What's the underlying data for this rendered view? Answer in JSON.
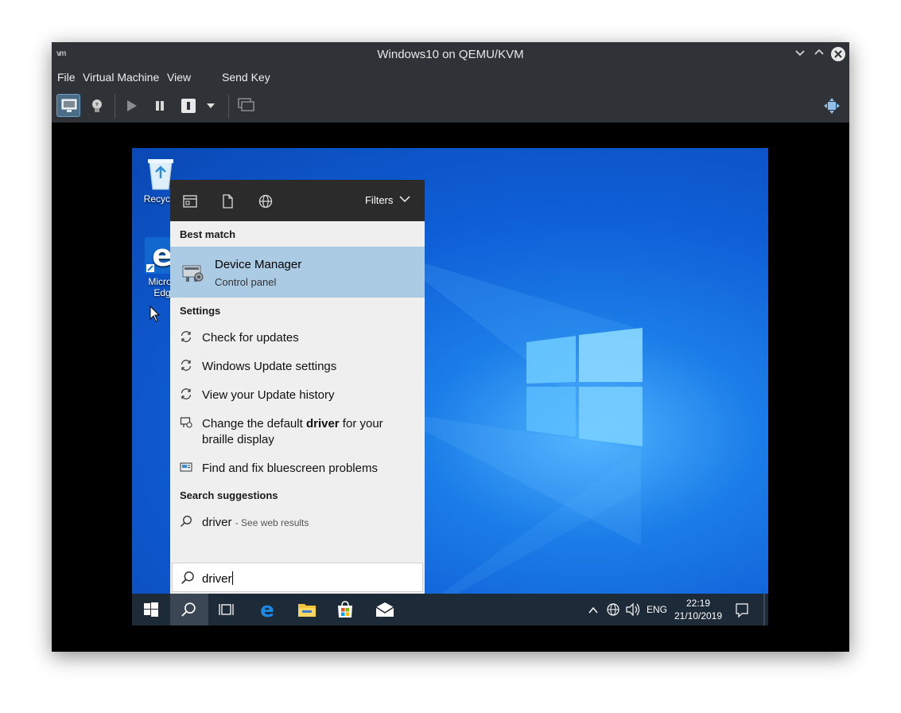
{
  "window": {
    "title": "Windows10 on QEMU/KVM",
    "app_logo": "vm"
  },
  "menubar": {
    "items": [
      "File",
      "Virtual Machine",
      "View",
      "Send Key"
    ]
  },
  "desktop": {
    "icons": [
      {
        "label": "Recycle",
        "icon": "recycle-bin-icon"
      },
      {
        "label": "Micros Edg",
        "icon": "edge-icon"
      }
    ]
  },
  "search_panel": {
    "filters_label": "Filters",
    "best_match": {
      "heading": "Best match",
      "title": "Device Manager",
      "subtitle": "Control panel"
    },
    "settings": {
      "heading": "Settings",
      "items": [
        {
          "pre": "Check for updates",
          "bold": "",
          "post": ""
        },
        {
          "pre": "Windows Update settings",
          "bold": "",
          "post": ""
        },
        {
          "pre": "View your Update history",
          "bold": "",
          "post": ""
        },
        {
          "pre": "Change the default ",
          "bold": "driver",
          "post": " for your braille display"
        },
        {
          "pre": "Find and fix bluescreen problems",
          "bold": "",
          "post": ""
        }
      ]
    },
    "suggestions": {
      "heading": "Search suggestions",
      "term": "driver",
      "suffix": "- See web results"
    },
    "query": "driver"
  },
  "taskbar": {
    "language": "ENG",
    "time": "22:19",
    "date": "21/10/2019"
  },
  "colors": {
    "titlebar": "#2f3337",
    "best_match_highlight": "#abcbe4",
    "taskbar": "#1d2a38",
    "desktop_blue": "#0f5ed6"
  }
}
